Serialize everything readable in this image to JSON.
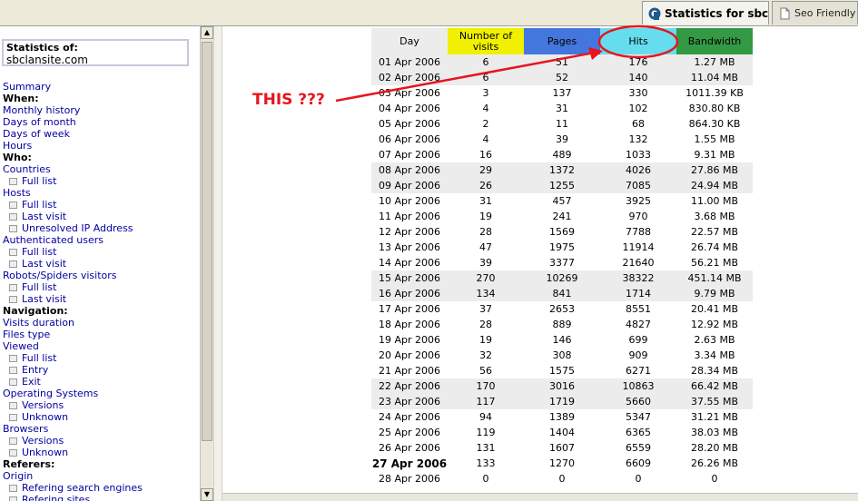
{
  "tabs": [
    {
      "label": "Statistics for sbcl...",
      "active": true
    },
    {
      "label": "Seo Friendly Di",
      "active": false
    }
  ],
  "stats_box": {
    "label": "Statistics of:",
    "site": "sbclansite.com"
  },
  "menu": [
    {
      "type": "link",
      "label": "Summary"
    },
    {
      "type": "hdr",
      "label": "When:"
    },
    {
      "type": "link",
      "label": "Monthly history"
    },
    {
      "type": "link",
      "label": "Days of month"
    },
    {
      "type": "link",
      "label": "Days of week"
    },
    {
      "type": "link",
      "label": "Hours"
    },
    {
      "type": "hdr",
      "label": "Who:"
    },
    {
      "type": "link",
      "label": "Countries"
    },
    {
      "type": "sub",
      "label": "Full list"
    },
    {
      "type": "link",
      "label": "Hosts"
    },
    {
      "type": "sub",
      "label": "Full list"
    },
    {
      "type": "sub",
      "label": "Last visit"
    },
    {
      "type": "sub",
      "label": "Unresolved IP Address"
    },
    {
      "type": "link",
      "label": "Authenticated users"
    },
    {
      "type": "sub",
      "label": "Full list"
    },
    {
      "type": "sub",
      "label": "Last visit"
    },
    {
      "type": "link",
      "label": "Robots/Spiders visitors"
    },
    {
      "type": "sub",
      "label": "Full list"
    },
    {
      "type": "sub",
      "label": "Last visit"
    },
    {
      "type": "hdr",
      "label": "Navigation:"
    },
    {
      "type": "link",
      "label": "Visits duration"
    },
    {
      "type": "link",
      "label": "Files type"
    },
    {
      "type": "link",
      "label": "Viewed"
    },
    {
      "type": "sub",
      "label": "Full list"
    },
    {
      "type": "sub",
      "label": "Entry"
    },
    {
      "type": "sub",
      "label": "Exit"
    },
    {
      "type": "link",
      "label": "Operating Systems"
    },
    {
      "type": "sub",
      "label": "Versions"
    },
    {
      "type": "sub",
      "label": "Unknown"
    },
    {
      "type": "link",
      "label": "Browsers"
    },
    {
      "type": "sub",
      "label": "Versions"
    },
    {
      "type": "sub",
      "label": "Unknown"
    },
    {
      "type": "hdr",
      "label": "Referers:"
    },
    {
      "type": "link",
      "label": "Origin"
    },
    {
      "type": "sub",
      "label": "Refering search engines"
    },
    {
      "type": "sub",
      "label": "Refering sites"
    }
  ],
  "table": {
    "headers": [
      {
        "label": "Day",
        "color": "#ececec"
      },
      {
        "label": "Number of visits",
        "color": "#f0f000"
      },
      {
        "label": "Pages",
        "color": "#4477dd"
      },
      {
        "label": "Hits",
        "color": "#66ddee"
      },
      {
        "label": "Bandwidth",
        "color": "#339944"
      }
    ],
    "rows": [
      [
        "01 Apr 2006",
        "6",
        "51",
        "176",
        "1.27 MB"
      ],
      [
        "02 Apr 2006",
        "6",
        "52",
        "140",
        "11.04 MB"
      ],
      [
        "03 Apr 2006",
        "3",
        "137",
        "330",
        "1011.39 KB"
      ],
      [
        "04 Apr 2006",
        "4",
        "31",
        "102",
        "830.80 KB"
      ],
      [
        "05 Apr 2006",
        "2",
        "11",
        "68",
        "864.30 KB"
      ],
      [
        "06 Apr 2006",
        "4",
        "39",
        "132",
        "1.55 MB"
      ],
      [
        "07 Apr 2006",
        "16",
        "489",
        "1033",
        "9.31 MB"
      ],
      [
        "08 Apr 2006",
        "29",
        "1372",
        "4026",
        "27.86 MB"
      ],
      [
        "09 Apr 2006",
        "26",
        "1255",
        "7085",
        "24.94 MB"
      ],
      [
        "10 Apr 2006",
        "31",
        "457",
        "3925",
        "11.00 MB"
      ],
      [
        "11 Apr 2006",
        "19",
        "241",
        "970",
        "3.68 MB"
      ],
      [
        "12 Apr 2006",
        "28",
        "1569",
        "7788",
        "22.57 MB"
      ],
      [
        "13 Apr 2006",
        "47",
        "1975",
        "11914",
        "26.74 MB"
      ],
      [
        "14 Apr 2006",
        "39",
        "3377",
        "21640",
        "56.21 MB"
      ],
      [
        "15 Apr 2006",
        "270",
        "10269",
        "38322",
        "451.14 MB"
      ],
      [
        "16 Apr 2006",
        "134",
        "841",
        "1714",
        "9.79 MB"
      ],
      [
        "17 Apr 2006",
        "37",
        "2653",
        "8551",
        "20.41 MB"
      ],
      [
        "18 Apr 2006",
        "28",
        "889",
        "4827",
        "12.92 MB"
      ],
      [
        "19 Apr 2006",
        "19",
        "146",
        "699",
        "2.63 MB"
      ],
      [
        "20 Apr 2006",
        "32",
        "308",
        "909",
        "3.34 MB"
      ],
      [
        "21 Apr 2006",
        "56",
        "1575",
        "6271",
        "28.34 MB"
      ],
      [
        "22 Apr 2006",
        "170",
        "3016",
        "10863",
        "66.42 MB"
      ],
      [
        "23 Apr 2006",
        "117",
        "1719",
        "5660",
        "37.55 MB"
      ],
      [
        "24 Apr 2006",
        "94",
        "1389",
        "5347",
        "31.21 MB"
      ],
      [
        "25 Apr 2006",
        "119",
        "1404",
        "6365",
        "38.03 MB"
      ],
      [
        "26 Apr 2006",
        "131",
        "1607",
        "6559",
        "28.20 MB"
      ],
      [
        "27 Apr 2006",
        "133",
        "1270",
        "6609",
        "26.26 MB"
      ],
      [
        "28 Apr 2006",
        "0",
        "0",
        "0",
        "0"
      ]
    ],
    "shaded_rows": [
      0,
      1,
      7,
      8,
      14,
      15,
      21,
      22
    ],
    "bold_rows": [
      26
    ]
  },
  "annotation": {
    "text": "THIS ???",
    "color": "#e8141e"
  }
}
